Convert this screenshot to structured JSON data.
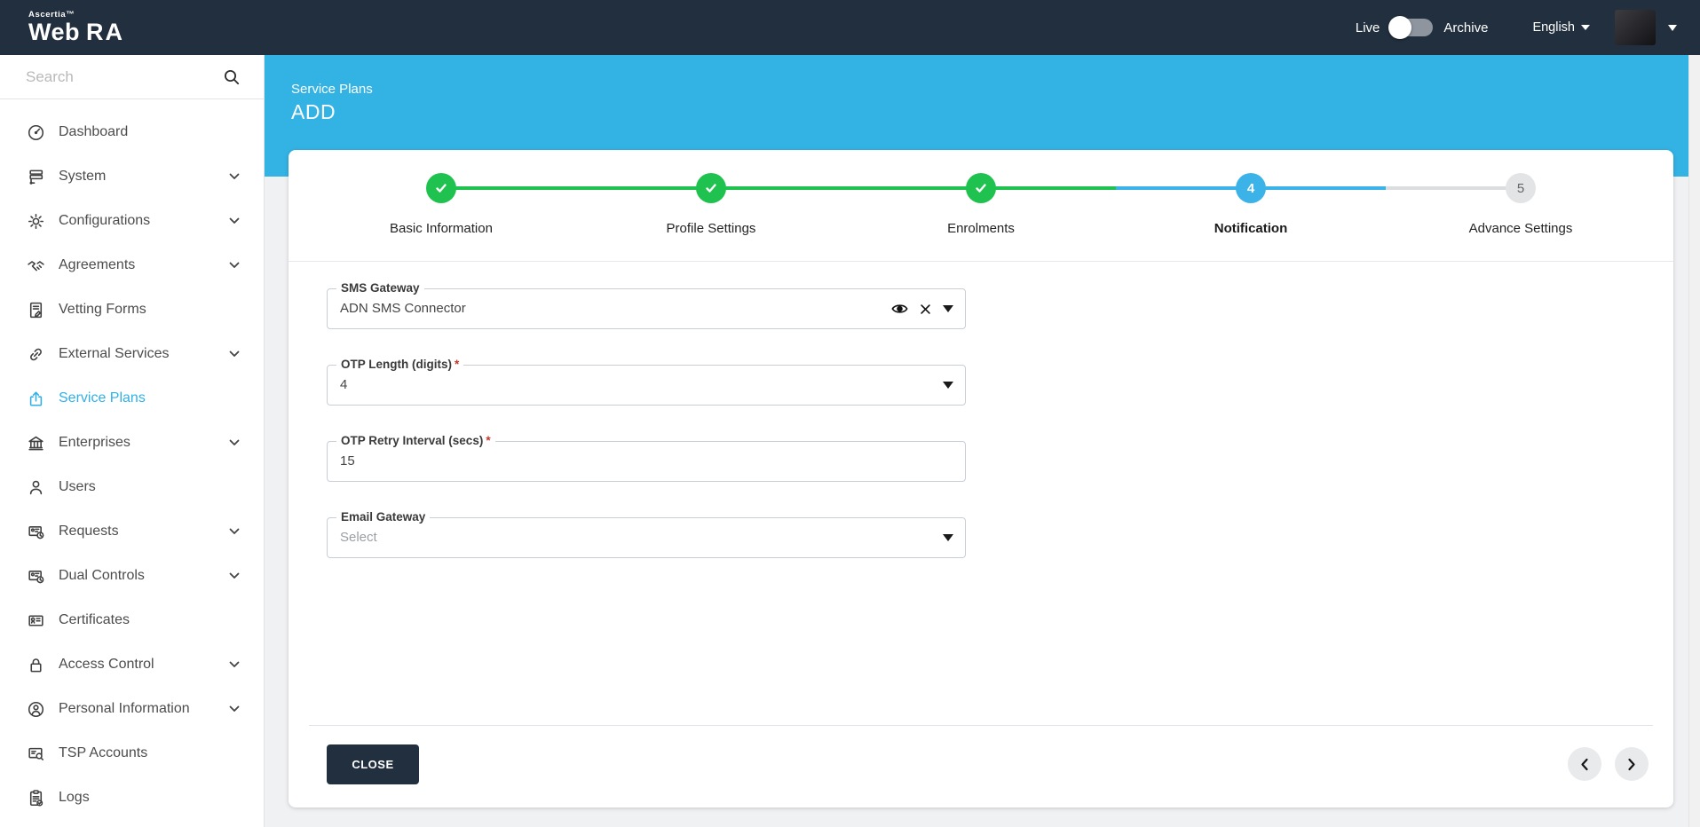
{
  "navbar": {
    "brand_top": "Ascertia™",
    "brand_web": "Web",
    "brand_ra": "RA",
    "live_label": "Live",
    "archive_label": "Archive",
    "language": "English",
    "toggle_state": "live"
  },
  "sidebar": {
    "search_placeholder": "Search",
    "items": [
      {
        "label": "Dashboard",
        "icon": "dashboard-icon",
        "active": false,
        "has_children": false
      },
      {
        "label": "System",
        "icon": "system-icon",
        "active": false,
        "has_children": true
      },
      {
        "label": "Configurations",
        "icon": "configurations-gear-icon",
        "active": false,
        "has_children": true
      },
      {
        "label": "Agreements",
        "icon": "agreements-handshake-icon",
        "active": false,
        "has_children": true
      },
      {
        "label": "Vetting Forms",
        "icon": "vetting-forms-icon",
        "active": false,
        "has_children": false
      },
      {
        "label": "External Services",
        "icon": "external-services-link-icon",
        "active": false,
        "has_children": true
      },
      {
        "label": "Service Plans",
        "icon": "service-plans-icon",
        "active": true,
        "has_children": false
      },
      {
        "label": "Enterprises",
        "icon": "enterprises-bank-icon",
        "active": false,
        "has_children": true
      },
      {
        "label": "Users",
        "icon": "users-icon",
        "active": false,
        "has_children": false
      },
      {
        "label": "Requests",
        "icon": "requests-icon",
        "active": false,
        "has_children": true
      },
      {
        "label": "Dual Controls",
        "icon": "dual-controls-icon",
        "active": false,
        "has_children": true
      },
      {
        "label": "Certificates",
        "icon": "certificates-icon",
        "active": false,
        "has_children": false
      },
      {
        "label": "Access Control",
        "icon": "access-control-lock-icon",
        "active": false,
        "has_children": true
      },
      {
        "label": "Personal Information",
        "icon": "personal-information-icon",
        "active": false,
        "has_children": true
      },
      {
        "label": "TSP Accounts",
        "icon": "tsp-accounts-icon",
        "active": false,
        "has_children": false
      },
      {
        "label": "Logs",
        "icon": "logs-icon",
        "active": false,
        "has_children": false
      }
    ]
  },
  "header": {
    "breadcrumb": "Service Plans",
    "title": "ADD"
  },
  "stepper": {
    "steps": [
      {
        "label": "Basic Information",
        "state": "completed"
      },
      {
        "label": "Profile Settings",
        "state": "completed"
      },
      {
        "label": "Enrolments",
        "state": "completed"
      },
      {
        "label": "Notification",
        "state": "active",
        "number": "4"
      },
      {
        "label": "Advance Settings",
        "state": "upcoming",
        "number": "5"
      }
    ]
  },
  "form": {
    "required_marker": "*",
    "fields": [
      {
        "label": "SMS Gateway",
        "value": "ADN SMS Connector",
        "required": false,
        "type": "select"
      },
      {
        "label": "OTP Length (digits)",
        "value": "4",
        "required": true,
        "type": "select"
      },
      {
        "label": "OTP Retry Interval (secs)",
        "value": "15",
        "required": true,
        "type": "text"
      },
      {
        "label": "Email Gateway",
        "placeholder": "Select",
        "required": false,
        "type": "select"
      }
    ]
  },
  "footer": {
    "close_label": "CLOSE"
  },
  "colors": {
    "navbar": "#222f3e",
    "header_blue": "#33b2e4",
    "active_link_blue": "#2fb1e8",
    "step_green": "#1fc24f",
    "step_blue": "#3bb2e8",
    "required_red": "#c0392b"
  }
}
